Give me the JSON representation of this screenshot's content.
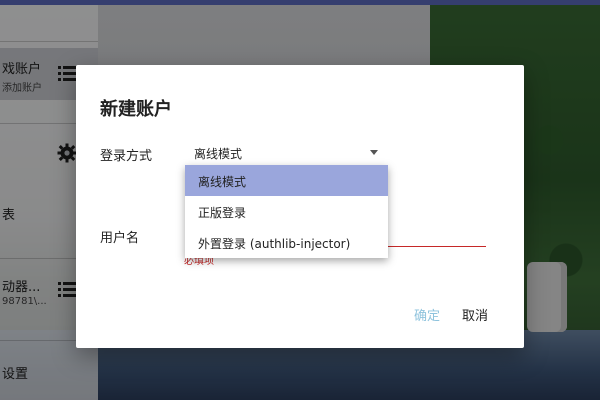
{
  "colors": {
    "accent": "#5c6bc0",
    "dropdown_selected": "#9aa6dc",
    "error": "#c62828",
    "ok_disabled": "#8fc3dd"
  },
  "sidebar": {
    "account_title": "戏账户",
    "account_subtitle": "添加账户",
    "account_icon": "list-icon",
    "settings_icon": "gear-icon",
    "item_list_label": "表",
    "launcher_title": "动器...",
    "launcher_subtitle": "98781\\...",
    "launcher_icon": "list-icon",
    "settings_label": "设置"
  },
  "dialog": {
    "title": "新建账户",
    "login_method_label": "登录方式",
    "login_method_value": "离线模式",
    "username_label": "用户名",
    "error_text": "必填项",
    "ok_label": "确定",
    "cancel_label": "取消"
  },
  "dropdown": {
    "options": [
      {
        "label": "离线模式",
        "selected": true
      },
      {
        "label": "正版登录",
        "selected": false
      },
      {
        "label": "外置登录 (authlib-injector)",
        "selected": false
      }
    ]
  }
}
